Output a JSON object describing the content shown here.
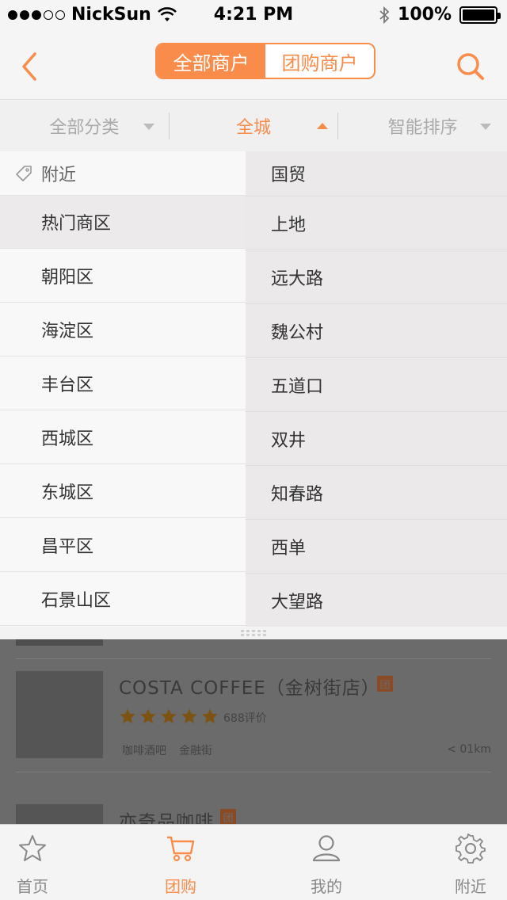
{
  "status_bar": {
    "carrier": "NickSun",
    "time": "4:21 PM",
    "battery": "100%"
  },
  "nav": {
    "segments": [
      "全部商户",
      "团购商户"
    ],
    "active_segment": 0
  },
  "filters": [
    {
      "label": "全部分类",
      "active": false
    },
    {
      "label": "全城",
      "active": true
    },
    {
      "label": "智能排序",
      "active": false
    }
  ],
  "left_list": {
    "header": "附近",
    "items": [
      "热门商区",
      "朝阳区",
      "海淀区",
      "丰台区",
      "西城区",
      "东城区",
      "昌平区",
      "石景山区"
    ]
  },
  "right_list": {
    "items": [
      "国贸",
      "上地",
      "远大路",
      "魏公村",
      "五道口",
      "双井",
      "知春路",
      "西单",
      "大望路"
    ]
  },
  "merchants": [
    {
      "name": "COSTA COFFEE（金树街店）",
      "badge": "团",
      "rating": 5,
      "reviews": "688评价",
      "tags": [
        "咖啡酒吧",
        "金融街"
      ],
      "distance": "< 01km"
    },
    {
      "name": "亦奇品咖啡",
      "badge": "团"
    }
  ],
  "tabbar": {
    "tabs": [
      "首页",
      "团购",
      "我的",
      "附近"
    ],
    "active": 1
  },
  "colors": {
    "accent": "#f98c4b",
    "dim_overlay": "#6b6b6b"
  }
}
